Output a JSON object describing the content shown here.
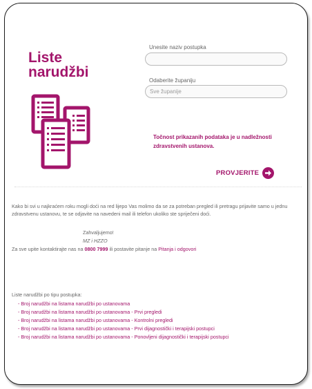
{
  "page": {
    "title_line1": "Liste",
    "title_line2": "narudžbi"
  },
  "form": {
    "procedure_label": "Unesite naziv postupka",
    "procedure_value": "",
    "county_label": "Odaberite županiju",
    "county_selected": "Sve županije"
  },
  "note": "Točnost prikazanih podataka je u nadležnosti zdravstvenih ustanova.",
  "check_button": "PROVJERITE",
  "message": {
    "text": "Kako bi svi u najkraćem roku mogli doći na red lijepo Vas molimo da se za potreban pregled ili pretragu prijavite samo u jednu zdravstvenu ustanovu, te se odjavite na navedeni mail ili telefon ukoliko ste spriječeni doći.",
    "thanks": "Zahvaljujemo!",
    "signature": "MZ i HZZO"
  },
  "contact": {
    "prefix": "Za sve upite kontaktirajte nas na",
    "phone": "0800 7999",
    "middle": "ili postavite pitanje na",
    "link": "Pitanja i odgovori"
  },
  "lists": {
    "heading": "Liste narudžbi po tipu postupka:",
    "items": [
      "- Broj narudžbi na listama narudžbi po ustanovama",
      "- Broj narudžbi na listama narudžbi po ustanovama - Prvi pregledi",
      "- Broj narudžbi na listama narudžbi po ustanovama - Kontrolni pregledi",
      "- Broj narudžbi na listama narudžbi po ustanovama - Prvi dijagnostički i terapijski postupci",
      "- Broj narudžbi na listama narudžbi po ustanovama - Ponovljeni dijagnostički i terapijski postupci"
    ]
  },
  "colors": {
    "accent": "#a3156b",
    "text": "#666666",
    "input_border": "#b9b9b9"
  },
  "icons": {
    "documents": "documents-icon",
    "arrow": "arrow-right-icon"
  }
}
